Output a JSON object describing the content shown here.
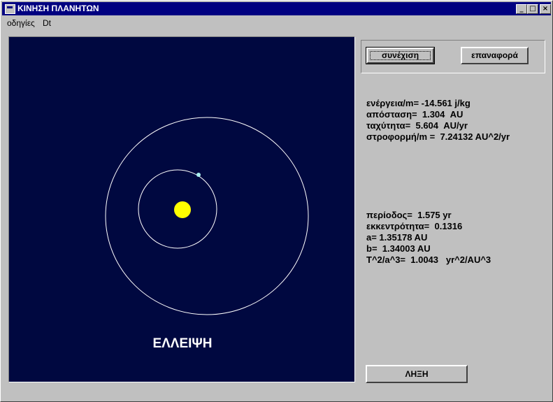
{
  "window": {
    "title": "ΚΙΝΗΣΗ ΠΛΑΝΗΤΩΝ",
    "minimize_glyph": "_",
    "maximize_glyph": "□",
    "close_glyph": "×"
  },
  "menu": {
    "items": [
      "οδηγίες",
      "Dt"
    ]
  },
  "simulation": {
    "shape_label": "ΕΛΛΕΙΨΗ",
    "background_color": "#000840",
    "sun_color": "#ffff00",
    "orbit_color": "#ffffff"
  },
  "controls": {
    "continue_label": "συνέχιση",
    "reset_label": "επαναφορά",
    "end_label": "ΛΗΞΗ"
  },
  "stats": {
    "energy": "ενέργεια/m= -14.561 j/kg",
    "distance": "απόσταση=  1.304  AU",
    "speed": "ταχύτητα=  5.604  AU/yr",
    "angular_momentum": "στροφορμή/m =  7.24132 AU^2/yr"
  },
  "orbit_stats": {
    "period": "περίοδος=  1.575 yr",
    "eccentricity": "εκκεντρότητα=  0.1316",
    "a": "a= 1.35178 AU",
    "b": "b=  1.34003 AU",
    "kepler": "T^2/a^3=  1.0043   yr^2/AU^3"
  }
}
